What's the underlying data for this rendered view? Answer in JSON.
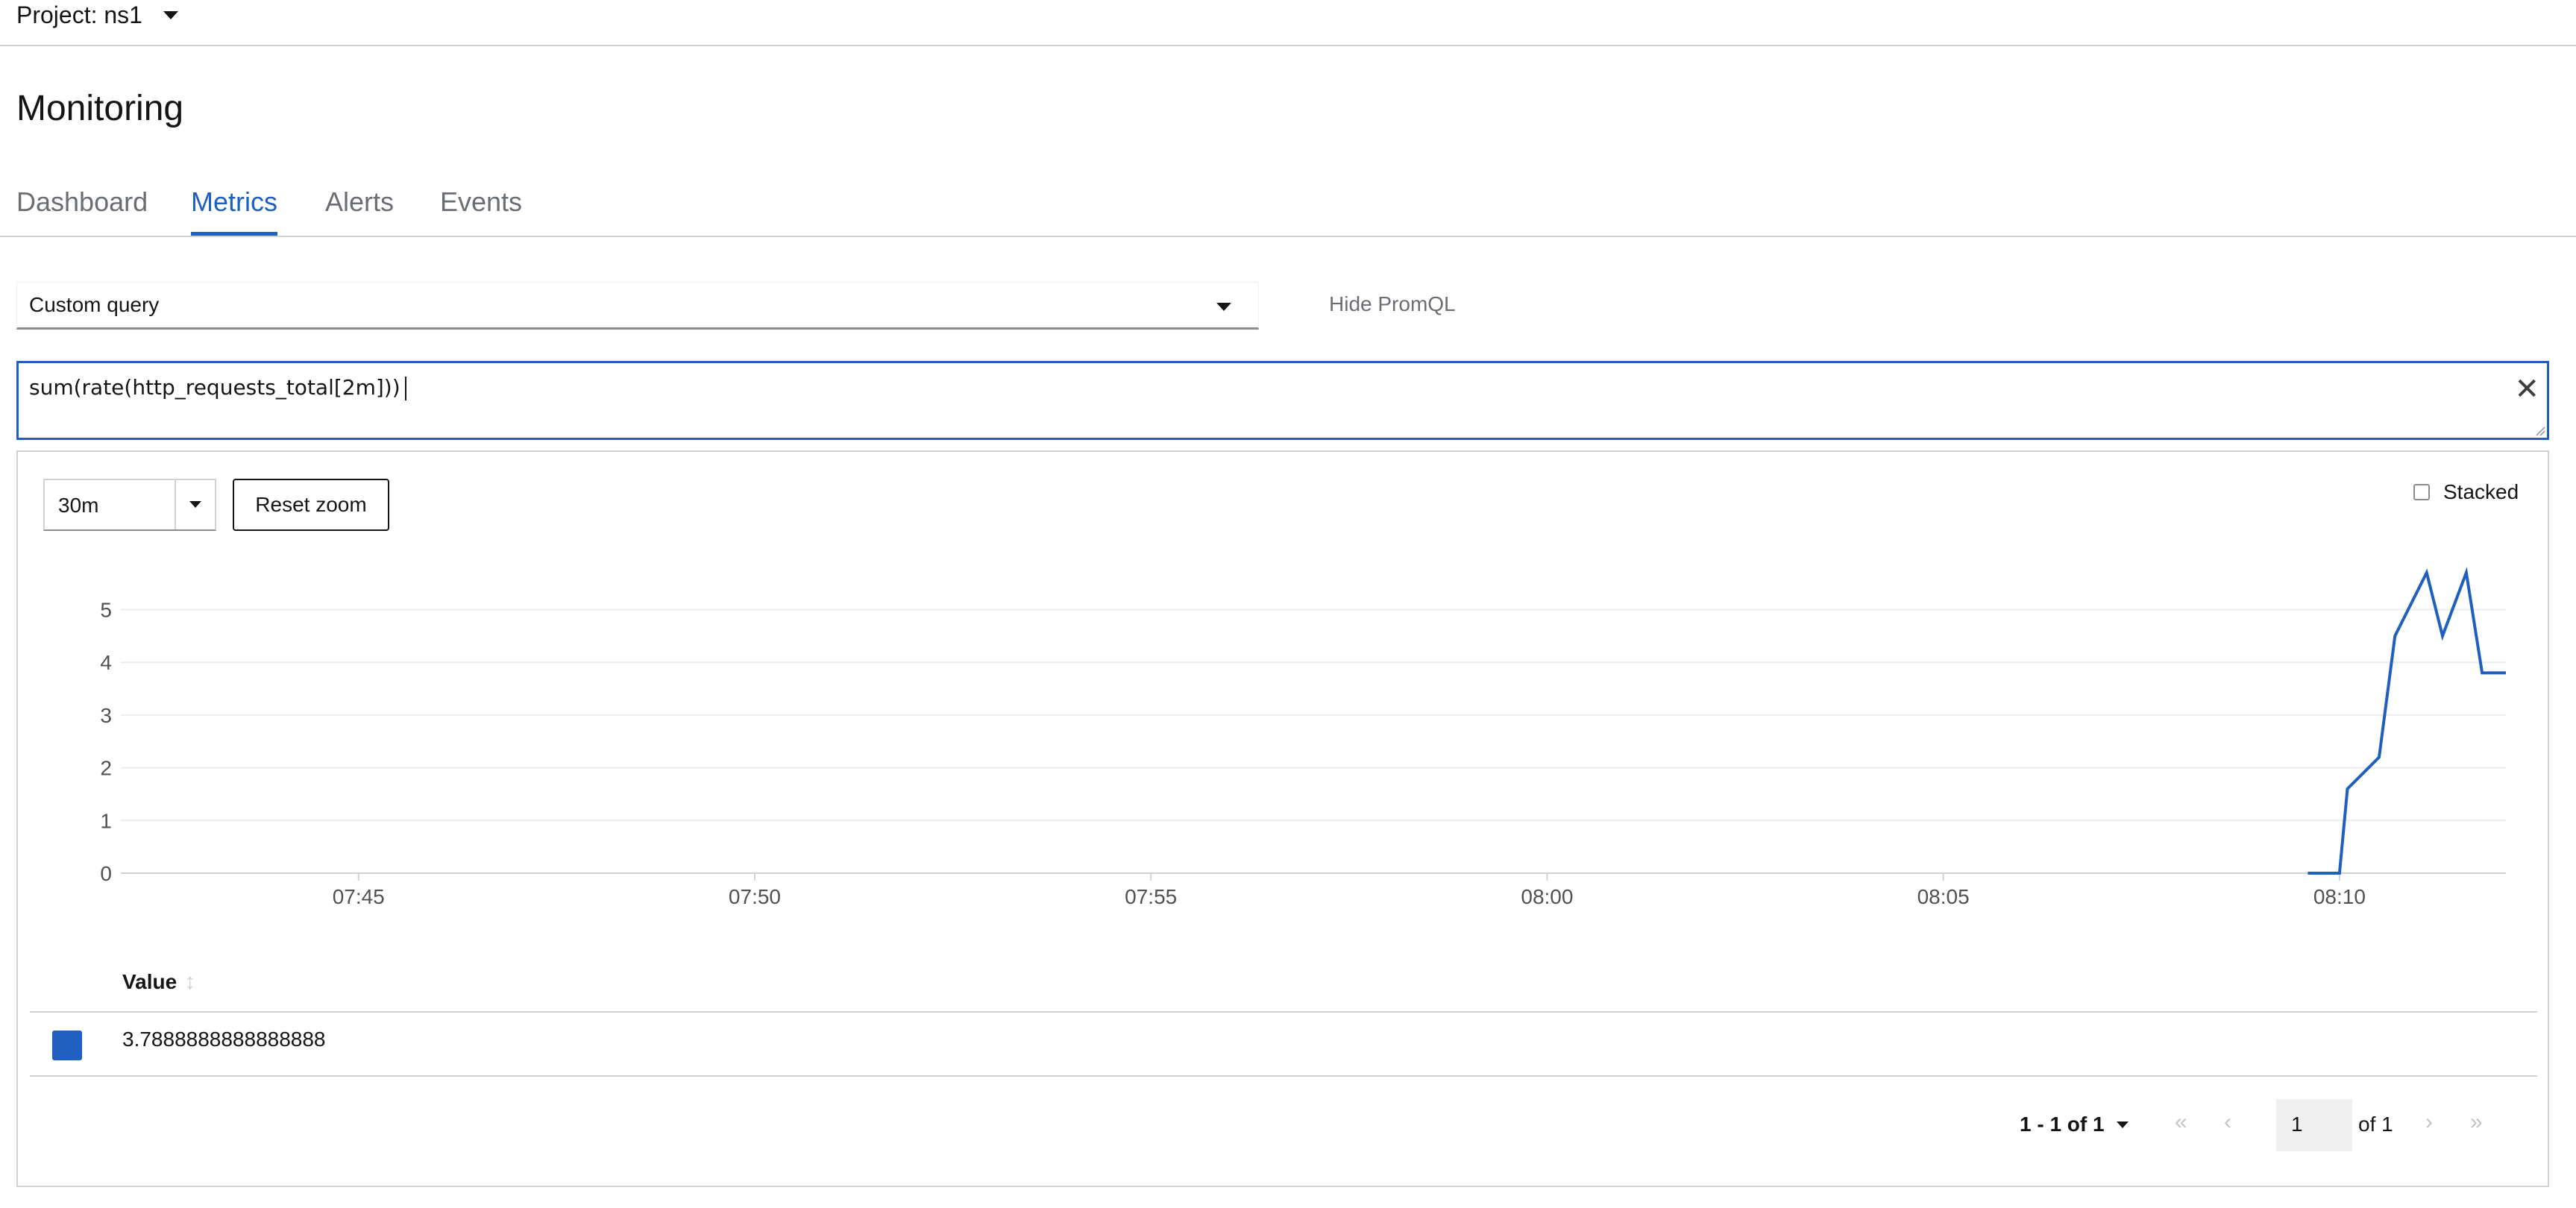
{
  "header": {
    "project_label": "Project: ns1"
  },
  "page": {
    "title": "Monitoring"
  },
  "tabs": [
    {
      "label": "Dashboard",
      "active": false
    },
    {
      "label": "Metrics",
      "active": true
    },
    {
      "label": "Alerts",
      "active": false
    },
    {
      "label": "Events",
      "active": false
    }
  ],
  "query_select": {
    "value": "Custom query"
  },
  "hide_promql_label": "Hide PromQL",
  "query_input": {
    "value": "sum(rate(http_requests_total[2m]))"
  },
  "toolbar": {
    "time_range": "30m",
    "reset_zoom_label": "Reset zoom",
    "stacked_label": "Stacked",
    "stacked_checked": false
  },
  "chart_data": {
    "type": "line",
    "title": "",
    "xlabel": "",
    "ylabel": "",
    "x_ticks": [
      "07:45",
      "07:50",
      "07:55",
      "08:00",
      "08:05",
      "08:10"
    ],
    "y_ticks": [
      "0",
      "1",
      "2",
      "3",
      "4",
      "5"
    ],
    "ylim": [
      0,
      5.7
    ],
    "xlim_minutes_from_0745": [
      -3.0,
      27.1
    ],
    "grid": true,
    "color": "#1f5fc0",
    "series": [
      {
        "x": [
          24.6,
          25.0,
          25.1,
          25.5,
          25.7,
          26.1,
          26.3,
          26.6,
          26.8,
          27.1
        ],
        "y": [
          0,
          0,
          1.6,
          2.2,
          4.5,
          5.7,
          4.5,
          5.7,
          3.8,
          3.8
        ]
      }
    ]
  },
  "table": {
    "header": "Value",
    "rows": [
      {
        "color": "#1f5fc0",
        "value": "3.7888888888888888"
      }
    ]
  },
  "pagination": {
    "range_label": "1 - 1 of 1",
    "page": "1",
    "of_label": "of 1"
  }
}
